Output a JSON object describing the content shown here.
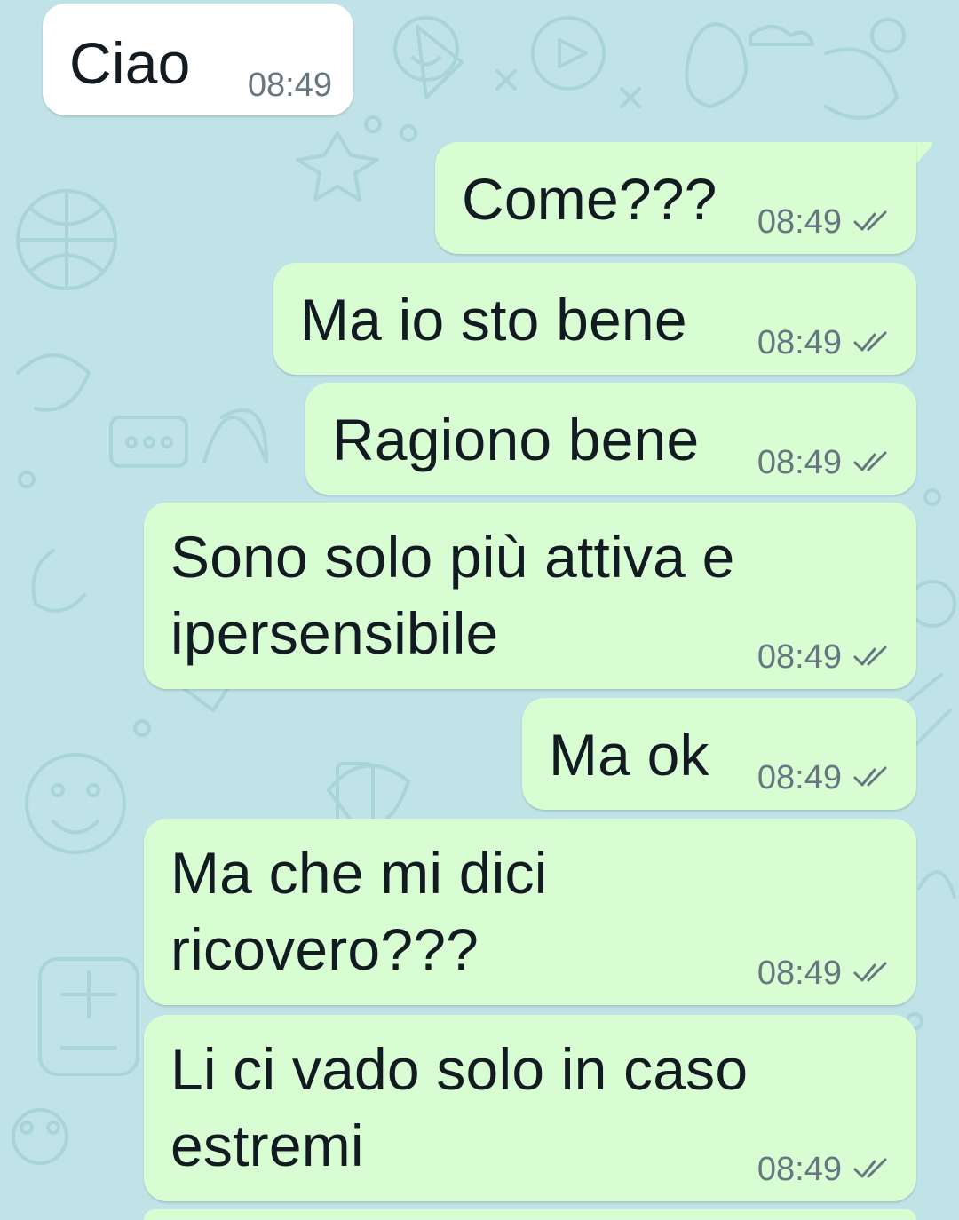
{
  "chat": {
    "messages": [
      {
        "direction": "in",
        "text": "Ciao",
        "time": "08:49",
        "status": ""
      },
      {
        "direction": "out",
        "text": "Come???",
        "time": "08:49",
        "status": "sent"
      },
      {
        "direction": "out",
        "text": "Ma io sto bene",
        "time": "08:49",
        "status": "sent"
      },
      {
        "direction": "out",
        "text": "Ragiono bene",
        "time": "08:49",
        "status": "sent"
      },
      {
        "direction": "out",
        "lines": [
          "Sono solo più attiva e",
          "ipersensibile"
        ],
        "time": "08:49",
        "status": "sent"
      },
      {
        "direction": "out",
        "text": "Ma ok",
        "time": "08:49",
        "status": "sent"
      },
      {
        "direction": "out",
        "lines": [
          "Ma che mi dici",
          "ricovero???"
        ],
        "time": "08:49",
        "status": "sent"
      },
      {
        "direction": "out",
        "lines": [
          "Li ci vado solo in caso",
          "estremi"
        ],
        "time": "08:49",
        "status": "sent"
      }
    ]
  },
  "theme": {
    "wallpaper_color": "#bfe3e6",
    "incoming_bubble": "#ffffff",
    "outgoing_bubble": "#d9fdd3",
    "meta_color": "#667781",
    "status_icon": "double-check-icon"
  }
}
